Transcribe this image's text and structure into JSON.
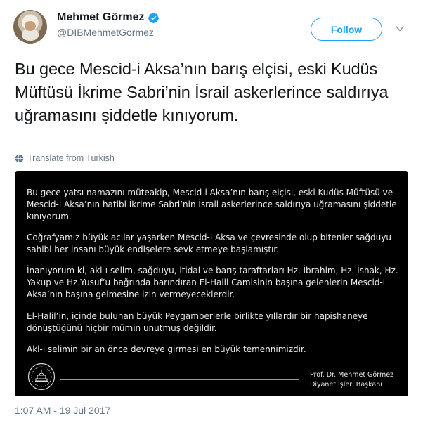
{
  "author": {
    "display_name": "Mehmet Görmez",
    "handle": "@DIBMehmetGormez",
    "verified": true
  },
  "follow_label": "Follow",
  "tweet_text": "Bu gece Mescid-i Aksa’nın barış elçisi, eski Kudüs Müftüsü İkrime Sabri’nin İsrail askerlerince saldırıya uğramasını şiddetle kınıyorum.",
  "translate_label": "Translate from Turkish",
  "media": {
    "paragraphs": [
      "Bu gece yatsı namazını müteakip, Mescid-i Aksa’nın barış elçisi, eski Kudüs Müftüsü ve Mescid-i Aksa’nın hatibi İkrime Sabri’nin İsrail askerlerince saldırıya uğramasını şiddetle kınıyorum.",
      "Coğrafyamız büyük acılar yaşarken Mescid-i Aksa ve çevresinde olup bitenler sağduyu sahibi her insanı büyük endişelere sevk etmeye başlamıştır.",
      "İnanıyorum ki, akl-ı selim, sağduyu, itidal ve barış taraftarları Hz. İbrahim, Hz. İshak, Hz. Yakup ve Hz.Yusuf’u bağrında barındıran El-Halil Camisinin başına gelenlerin Mescid-i Aksa’nın başına gelmesine izin vermeyeceklerdir.",
      "El-Halil’in, içinde bulunan büyük Peygamberlerle birlikte yıllardır bir hapishaneye dönüştüğünü hiçbir mümin unutmuş değildir.",
      "Akl-ı selimin bir an önce devreye girmesi en büyük temennimizdir."
    ],
    "signer_name": "Prof. Dr. Mehmet Görmez",
    "signer_title": "Diyanet İşleri Başkanı"
  },
  "timestamp": "1:07 AM - 19 Jul 2017",
  "colors": {
    "accent": "#1da1f2",
    "muted": "#657786",
    "text": "#14171a",
    "media_bg": "#000000"
  },
  "icons": [
    "verified-badge-icon",
    "chevron-down-icon",
    "globe-icon",
    "diyanet-seal-icon"
  ]
}
